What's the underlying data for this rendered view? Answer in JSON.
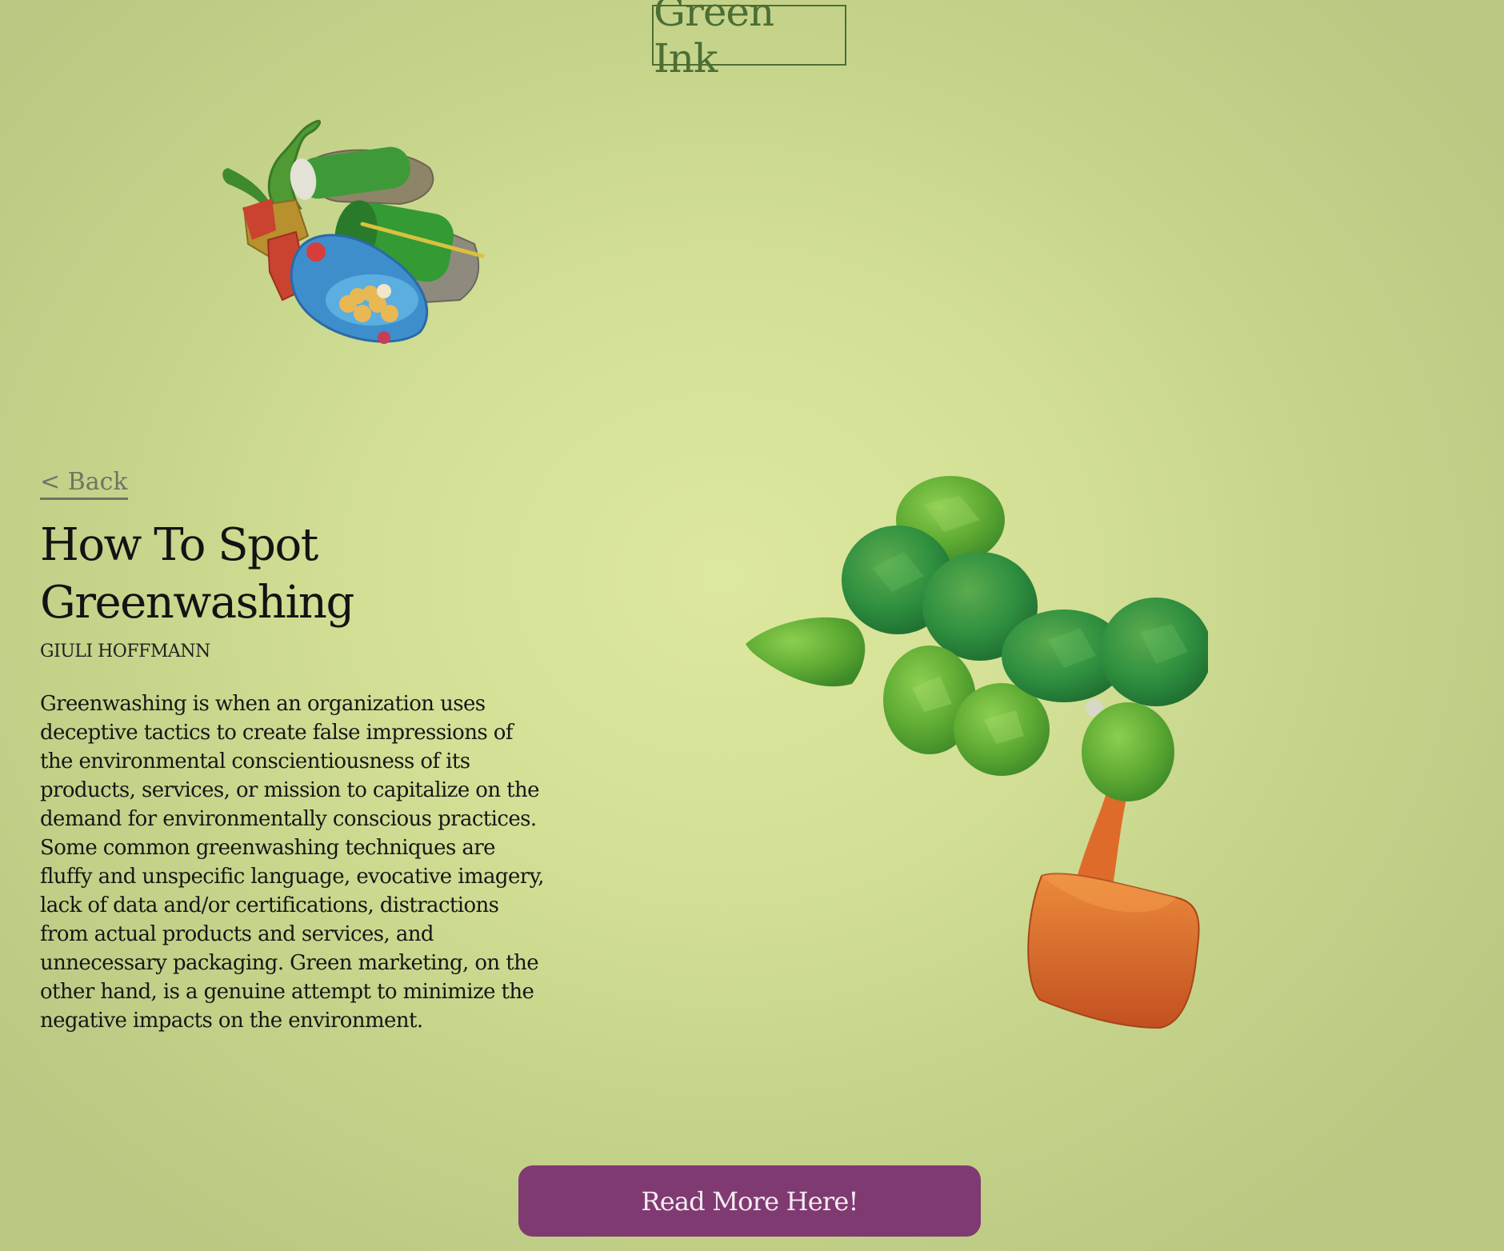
{
  "header": {
    "brand": "Green Ink"
  },
  "nav": {
    "back_label": "< Back"
  },
  "article": {
    "title": "How To Spot Greenwashing",
    "author": "GIULI HOFFMANN",
    "body": "Greenwashing is when an organization uses deceptive tactics to create false impressions of the environmental conscientiousness of its products, services, or mission to capitalize on the demand for environmentally conscious practices. Some common greenwashing techniques are fluffy and unspecific language, evocative imagery, lack of data and/or certifications, distractions from actual products and services, and unnecessary packaging. Green marketing, on the other hand, is a genuine attempt to minimize the negative impacts on the environment."
  },
  "cta": {
    "label": "Read More Here!"
  },
  "colors": {
    "background": "#d2df95",
    "brand_green": "#4b6e35",
    "cta_purple": "#803a72",
    "leaf_green": "#2f8a3e",
    "pot_orange": "#d8622a"
  }
}
